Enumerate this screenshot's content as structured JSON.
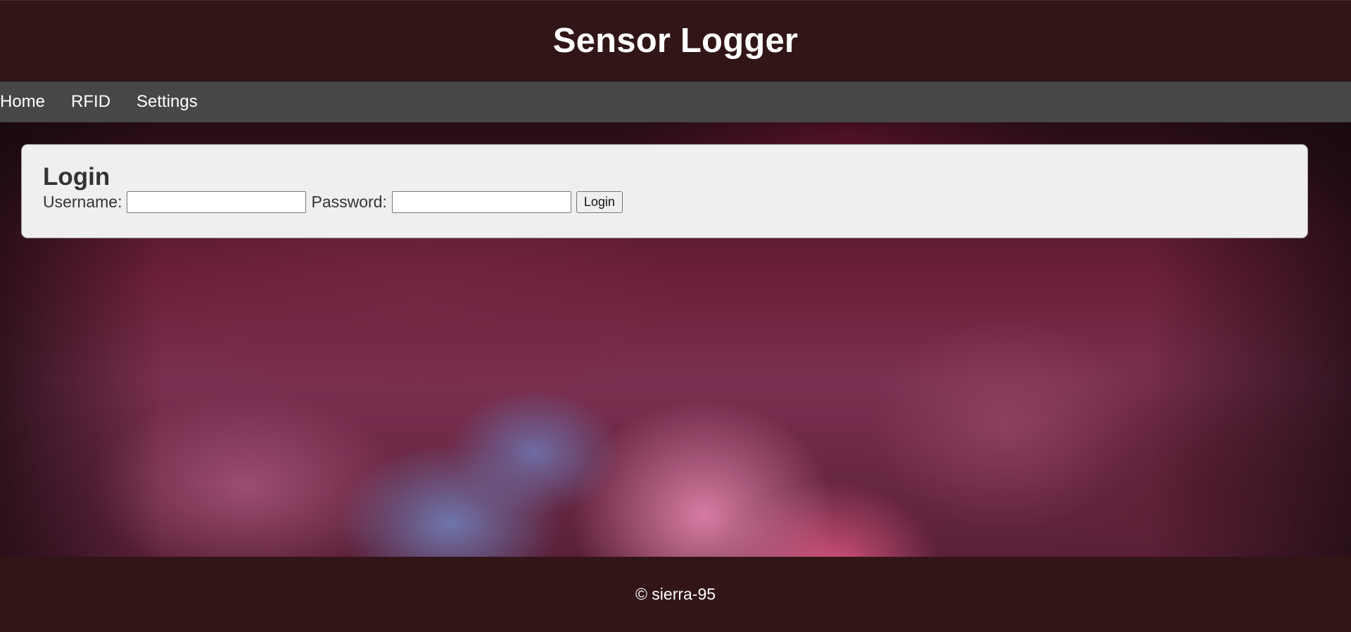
{
  "header": {
    "title": "Sensor Logger"
  },
  "nav": {
    "items": [
      {
        "label": "Home"
      },
      {
        "label": "RFID"
      },
      {
        "label": "Settings"
      }
    ]
  },
  "login": {
    "title": "Login",
    "username_label": "Username:",
    "username_value": "",
    "password_label": "Password:",
    "password_value": "",
    "submit_label": "Login"
  },
  "footer": {
    "text": "© sierra-95"
  },
  "colors": {
    "header_bg": "#311517",
    "nav_bg": "#474747",
    "card_bg": "#efefef",
    "footer_bg": "#311517"
  }
}
